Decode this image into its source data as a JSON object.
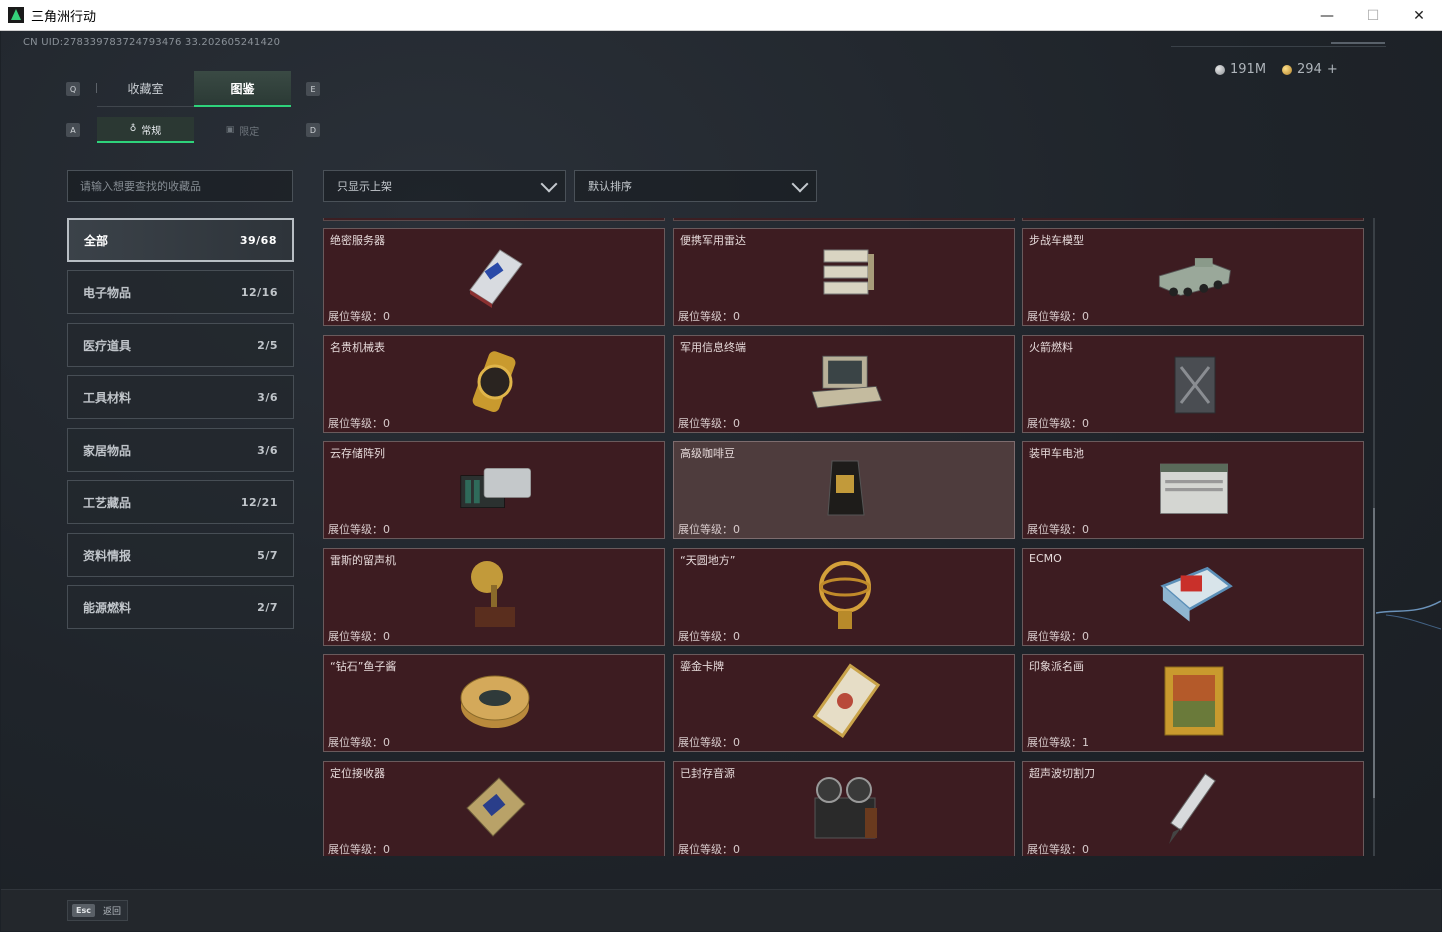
{
  "window": {
    "title": "三角洲行动",
    "minimize": "—",
    "maximize": "☐",
    "close": "✕"
  },
  "uid_text": "CN UID:278339783724793476 33.202605241420",
  "currency": [
    {
      "icon": "silver-coin-icon",
      "value": "191M"
    },
    {
      "icon": "gold-coin-icon",
      "value": "294"
    }
  ],
  "currency_add": "+",
  "keys": {
    "left_main": "Q",
    "right_main": "E",
    "left_sub": "A",
    "right_sub": "D"
  },
  "main_tabs": [
    {
      "label": "收藏室",
      "active": false
    },
    {
      "label": "图鉴",
      "active": true
    }
  ],
  "sub_tabs": [
    {
      "label": "常规",
      "active": true
    },
    {
      "label": "限定",
      "active": false
    }
  ],
  "search": {
    "placeholder": "请输入想要查找的收藏品",
    "value": ""
  },
  "filters": {
    "shelf": {
      "value": "只显示上架"
    },
    "sort": {
      "value": "默认排序"
    }
  },
  "categories": [
    {
      "label": "全部",
      "count": "39/68",
      "active": true
    },
    {
      "label": "电子物品",
      "count": "12/16",
      "active": false
    },
    {
      "label": "医疗道具",
      "count": "2/5",
      "active": false
    },
    {
      "label": "工具材料",
      "count": "3/6",
      "active": false
    },
    {
      "label": "家居物品",
      "count": "3/6",
      "active": false
    },
    {
      "label": "工艺藏品",
      "count": "12/21",
      "active": false
    },
    {
      "label": "资料情报",
      "count": "5/7",
      "active": false
    },
    {
      "label": "能源燃料",
      "count": "2/7",
      "active": false
    }
  ],
  "level_prefix": "展位等级：",
  "items": [
    {
      "name": "绝密服务器",
      "level": "0",
      "icon": "server-icon"
    },
    {
      "name": "便携军用雷达",
      "level": "0",
      "icon": "radar-icon"
    },
    {
      "name": "步战车模型",
      "level": "0",
      "icon": "ifv-model-icon"
    },
    {
      "name": "名贵机械表",
      "level": "0",
      "icon": "watch-icon"
    },
    {
      "name": "军用信息终端",
      "level": "0",
      "icon": "terminal-icon"
    },
    {
      "name": "火箭燃料",
      "level": "0",
      "icon": "fuel-can-icon"
    },
    {
      "name": "云存储阵列",
      "level": "0",
      "icon": "storage-array-icon"
    },
    {
      "name": "高级咖啡豆",
      "level": "0",
      "icon": "coffee-bag-icon",
      "highlight": true
    },
    {
      "name": "装甲车电池",
      "level": "0",
      "icon": "battery-icon"
    },
    {
      "name": "雷斯的留声机",
      "level": "0",
      "icon": "gramophone-icon"
    },
    {
      "name": "“天圆地方”",
      "level": "0",
      "icon": "armillary-icon"
    },
    {
      "name": "ECMO",
      "level": "0",
      "icon": "ecmo-icon"
    },
    {
      "name": "“钻石”鱼子酱",
      "level": "0",
      "icon": "caviar-tin-icon"
    },
    {
      "name": "鎏金卡牌",
      "level": "0",
      "icon": "gold-card-icon"
    },
    {
      "name": "印象派名画",
      "level": "1",
      "icon": "painting-icon"
    },
    {
      "name": "定位接收器",
      "level": "0",
      "icon": "gps-receiver-icon"
    },
    {
      "name": "已封存音源",
      "level": "0",
      "icon": "tape-recorder-icon"
    },
    {
      "name": "超声波切割刀",
      "level": "0",
      "icon": "cutter-icon"
    }
  ],
  "colors": {
    "accent_green": "#2ed37b",
    "card_bg": "#3d1c21",
    "card_highlight_bg": "#4e3c3d"
  },
  "bottom": {
    "esc_key": "Esc",
    "esc_label": "返回"
  }
}
